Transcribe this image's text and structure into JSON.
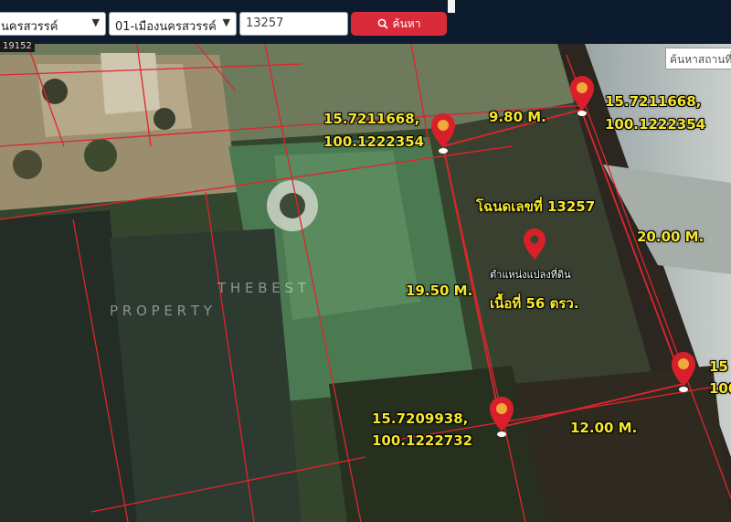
{
  "toolbar": {
    "province_select": "นครสวรรค์",
    "district_select": "01-เมืองนครสวรรค์",
    "deed_input": "13257",
    "search_button": "ค้นหา"
  },
  "map": {
    "parcel_tag": "19152",
    "place_search_placeholder": "ค้นหาสถานที่",
    "deed_title": "โฉนดเลขที่ 13257",
    "parcel_position_caption": "ตำแหน่งแปลงที่ดิน",
    "area_label": "เนื้อที่ 56 ตรว.",
    "side_top": "9.80 M.",
    "side_right": "20.00 M.",
    "side_left": "19.50 M.",
    "side_bottom": "12.00 M.",
    "coord_top_left_lat": "15.7211668,",
    "coord_top_left_lon": "100.1222354",
    "coord_top_right_lat": "15.7211668,",
    "coord_top_right_lon": "100.1222354",
    "coord_bottom_left_lat": "15.7209938,",
    "coord_bottom_left_lon": "100.1222732",
    "coord_right_lat_partial": "15",
    "coord_right_lon_partial": "100",
    "watermark_line1": "T H E   B E S T",
    "watermark_line2": "P R O P E R T Y"
  },
  "colors": {
    "parcel_lines": "#e0242e",
    "label_text": "#f5e62d",
    "pin_red": "#d9202a",
    "pin_top_yellow": "#f2a93b",
    "topbar": "#0d1b2e",
    "search_button": "#d92b3a"
  }
}
